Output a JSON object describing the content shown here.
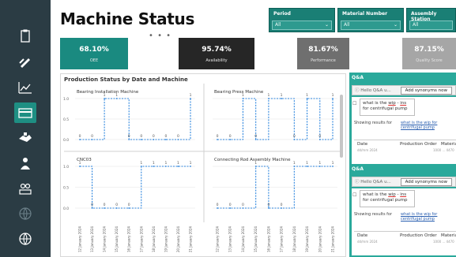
{
  "page": {
    "title": "Machine Status"
  },
  "nav": {
    "icons": [
      "clipboard-icon",
      "hand-wrench-icon",
      "line-chart-icon",
      "card-icon",
      "handshake-icon",
      "worker-icon",
      "team-icon",
      "globe-icon",
      "settings-globe-icon"
    ],
    "active_index": 3
  },
  "slicers": [
    {
      "label": "Period",
      "value": "All"
    },
    {
      "label": "Material Number",
      "value": "All"
    },
    {
      "label": "Assembly Station",
      "value": "All"
    }
  ],
  "kpis": [
    {
      "value": "68.10%",
      "label": "OEE",
      "color": "#1a8a80"
    },
    {
      "value": "95.74%",
      "label": "Availability",
      "color": "#262626"
    },
    {
      "value": "81.67%",
      "label": "Performance",
      "color": "#6f6f6f"
    },
    {
      "value": "87.15%",
      "label": "Quality Score",
      "color": "#a6a6a6"
    }
  ],
  "chart_title": "Production Status by Date and Machine",
  "chart_data": [
    {
      "type": "line",
      "title": "Bearing Installation Machine",
      "x": [
        "12 January 2024",
        "13 January 2024",
        "14 January 2024",
        "15 January 2024",
        "16 January 2024",
        "17 January 2024",
        "18 January 2024",
        "19 January 2024",
        "20 January 2024",
        "21 January 2024"
      ],
      "values": [
        0,
        0,
        1,
        1,
        0,
        0,
        0,
        0,
        0,
        1
      ],
      "data_labels": [
        "0",
        "0",
        "1",
        "1",
        "0",
        "0",
        "0",
        "0",
        "0",
        "1"
      ],
      "yticks": [
        "1.0",
        "0.5",
        "0.0"
      ],
      "ylim": [
        0,
        1
      ]
    },
    {
      "type": "line",
      "title": "Bearing Press Machine",
      "x": [
        "12 January 2024",
        "13 January 2024",
        "14 January 2024",
        "15 January 2024",
        "16 January 2024",
        "17 January 2024",
        "18 January 2024",
        "19 January 2024",
        "20 January 2024",
        "21 January 2024"
      ],
      "values": [
        0,
        0,
        1,
        0,
        1,
        1,
        0,
        1,
        0,
        1
      ],
      "data_labels": [
        "0",
        "0",
        "1",
        "0",
        "1",
        "1",
        "0",
        "1",
        "0",
        "1"
      ],
      "ylim": [
        0,
        1
      ]
    },
    {
      "type": "line",
      "title": "CNC03",
      "x": [
        "12 January 2024",
        "13 January 2024",
        "14 January 2024",
        "15 January 2024",
        "16 January 2024",
        "17 January 2024",
        "18 January 2024",
        "19 January 2024",
        "20 January 2024",
        "21 January 2024"
      ],
      "values": [
        1,
        0,
        0,
        0,
        0,
        1,
        1,
        1,
        1,
        1
      ],
      "data_labels": [
        "1",
        "0",
        "0",
        "0",
        "0",
        "1",
        "1",
        "1",
        "1",
        "1"
      ],
      "yticks": [
        "1.0",
        "0.5",
        "0.0"
      ],
      "ylim": [
        0,
        1
      ]
    },
    {
      "type": "line",
      "title": "Connecting Rod Assembly Machine",
      "x": [
        "12 January 2024",
        "13 January 2024",
        "14 January 2024",
        "15 January 2024",
        "16 January 2024",
        "17 January 2024",
        "18 January 2024",
        "19 January 2024",
        "20 January 2024",
        "21 January 2024"
      ],
      "values": [
        0,
        0,
        0,
        1,
        0,
        0,
        1,
        1,
        1,
        1
      ],
      "data_labels": [
        "0",
        "0",
        "0",
        "1",
        "0",
        "0",
        "1",
        "1",
        "1",
        "1"
      ],
      "ylim": [
        0,
        1
      ]
    }
  ],
  "chart_colors": {
    "line": "#2e86de",
    "grid": "#e3e3e3",
    "divider": "#d0d0d0"
  },
  "qna": {
    "sections": [
      {
        "header": "Q&A",
        "ask_placeholder": "Hello Q&A u...",
        "synonyms_button": "Add synonyms now",
        "question_parts": [
          "what is the ",
          "wip",
          " - ",
          "ins",
          " for centrifugal pump"
        ],
        "showing_label": "Showing results for",
        "result_link": "what is the wip for centrifugal pump",
        "table_headers": [
          "Date",
          "Production Order",
          "Material"
        ],
        "blurred": [
          "dd/mm 2024",
          "1000 ... 4470"
        ]
      },
      {
        "header": "Q&A",
        "ask_placeholder": "Hello Q&A u...",
        "synonyms_button": "Add synonyms now",
        "question_parts": [
          "what is the ",
          "wip",
          " - ",
          "ins",
          " for centrifugal pump"
        ],
        "showing_label": "Showing results for",
        "result_link": "what is the wip for centrifugal pump",
        "table_headers": [
          "Date",
          "Production Order",
          "Material"
        ],
        "blurred": [
          "dd/mm 2024",
          "1000 ... 4470"
        ]
      }
    ]
  }
}
